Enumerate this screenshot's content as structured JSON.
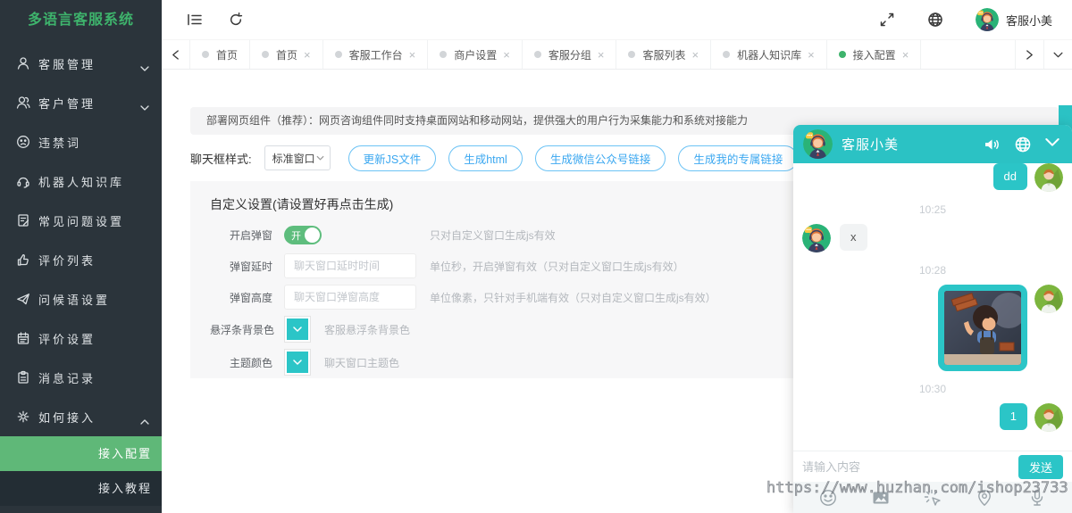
{
  "app": {
    "title": "多语言客服系统"
  },
  "topbar": {
    "user_name": "客服小美"
  },
  "sidebar": {
    "items": [
      {
        "label": "客服管理",
        "icon": "user-icon",
        "expandable": true
      },
      {
        "label": "客户管理",
        "icon": "users-icon",
        "expandable": true
      },
      {
        "label": "违禁词",
        "icon": "sad-face-icon"
      },
      {
        "label": "机器人知识库",
        "icon": "headset-icon"
      },
      {
        "label": "常见问题设置",
        "icon": "doc-edit-icon"
      },
      {
        "label": "评价列表",
        "icon": "thumbs-up-icon"
      },
      {
        "label": "问候语设置",
        "icon": "paper-plane-icon"
      },
      {
        "label": "评价设置",
        "icon": "calendar-icon"
      },
      {
        "label": "消息记录",
        "icon": "clipboard-icon"
      },
      {
        "label": "如何接入",
        "icon": "gear-icon",
        "expandable": true,
        "expanded": true
      }
    ],
    "subitems": [
      {
        "label": "接入配置",
        "active": true
      },
      {
        "label": "接入教程",
        "active": false
      }
    ]
  },
  "tabs": {
    "close_glyph": "×",
    "items": [
      {
        "label": "首页",
        "closable": false,
        "active": false
      },
      {
        "label": "首页",
        "closable": true,
        "active": false
      },
      {
        "label": "客服工作台",
        "closable": true,
        "active": false
      },
      {
        "label": "商户设置",
        "closable": true,
        "active": false
      },
      {
        "label": "客服分组",
        "closable": true,
        "active": false
      },
      {
        "label": "客服列表",
        "closable": true,
        "active": false
      },
      {
        "label": "机器人知识库",
        "closable": true,
        "active": false
      },
      {
        "label": "接入配置",
        "closable": true,
        "active": true
      }
    ]
  },
  "notice": {
    "text": "部署网页组件（推荐）：网页咨询组件同时支持桌面网站和移动网站，提供强大的用户行为采集能力和系统对接能力"
  },
  "controls": {
    "style_label": "聊天框样式:",
    "style_value": "标准窗口",
    "buttons": [
      {
        "label": "更新JS文件"
      },
      {
        "label": "生成html"
      },
      {
        "label": "生成微信公众号链接"
      },
      {
        "label": "生成我的专属链接"
      }
    ]
  },
  "settings": {
    "title": "自定义设置(请设置好再点击生成)",
    "rows": [
      {
        "label": "开启弹窗",
        "type": "toggle",
        "toggle_text": "开",
        "state": "on",
        "hint": "只对自定义窗口生成js有效"
      },
      {
        "label": "弹窗延时",
        "type": "input",
        "value": "",
        "placeholder": "聊天窗口延时时间",
        "hint": "单位秒，开启弹窗有效（只对自定义窗口生成js有效）"
      },
      {
        "label": "弹窗高度",
        "type": "input",
        "value": "",
        "placeholder": "聊天窗口弹窗高度",
        "hint": "单位像素，只针对手机端有效（只对自定义窗口生成js有效）"
      },
      {
        "label": "悬浮条背景色",
        "type": "color",
        "color": "#2bc5c7",
        "hint": "客服悬浮条背景色"
      },
      {
        "label": "主题颜色",
        "type": "color",
        "color": "#2bc5c7",
        "hint": "聊天窗口主题色"
      }
    ]
  },
  "chat": {
    "title": "客服小美",
    "messages": [
      {
        "kind": "text",
        "side": "right",
        "text": "dd"
      },
      {
        "kind": "time",
        "text": "10:25"
      },
      {
        "kind": "text",
        "side": "left",
        "text": "x"
      },
      {
        "kind": "time",
        "text": "10:28"
      },
      {
        "kind": "image",
        "side": "right",
        "description": "cartoon-boy-carrying-bricks"
      },
      {
        "kind": "time",
        "text": "10:30"
      },
      {
        "kind": "text",
        "side": "right",
        "text": "1"
      }
    ],
    "input_placeholder": "请输入内容",
    "send_label": "发送"
  },
  "watermark": {
    "text": "https://www.huzhan.com/ishop23733"
  },
  "colors": {
    "teal": "#2bc4c6",
    "green_active": "#5fb878",
    "title_green": "#3eb36c",
    "blue_button": "#3aa7f0",
    "sidebar_bg": "#2b343b"
  }
}
